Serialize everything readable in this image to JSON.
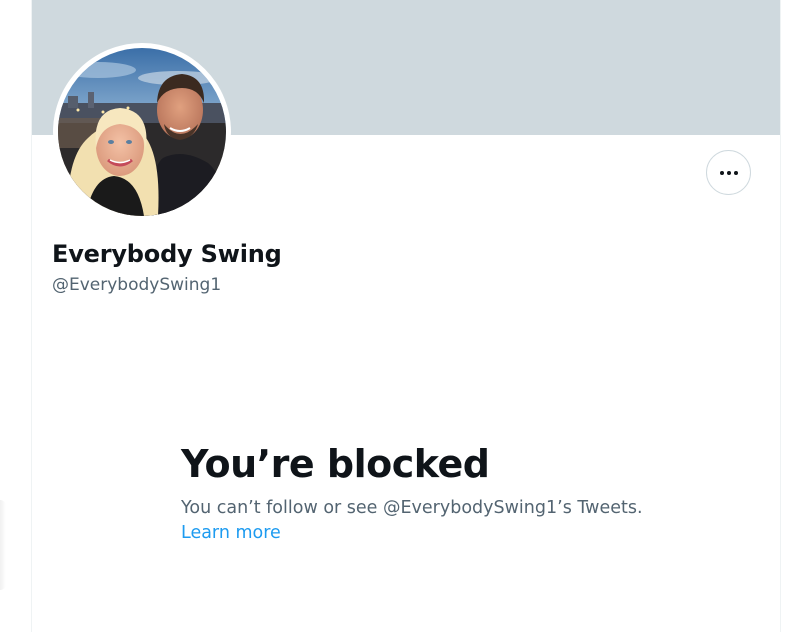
{
  "profile": {
    "display_name": "Everybody Swing",
    "handle": "@EverybodySwing1",
    "banner_color": "#cfd9de",
    "avatar_icon": "profile-photo-couple"
  },
  "actions": {
    "more_icon": "ellipsis-horizontal-icon"
  },
  "blocked_notice": {
    "title": "You’re blocked",
    "description": "You can’t follow or see @EverybodySwing1’s Tweets.",
    "learn_more_label": "Learn more"
  },
  "colors": {
    "text_primary": "#0f1419",
    "text_secondary": "#536471",
    "link": "#1d9bf0",
    "border": "#cfd9de"
  }
}
